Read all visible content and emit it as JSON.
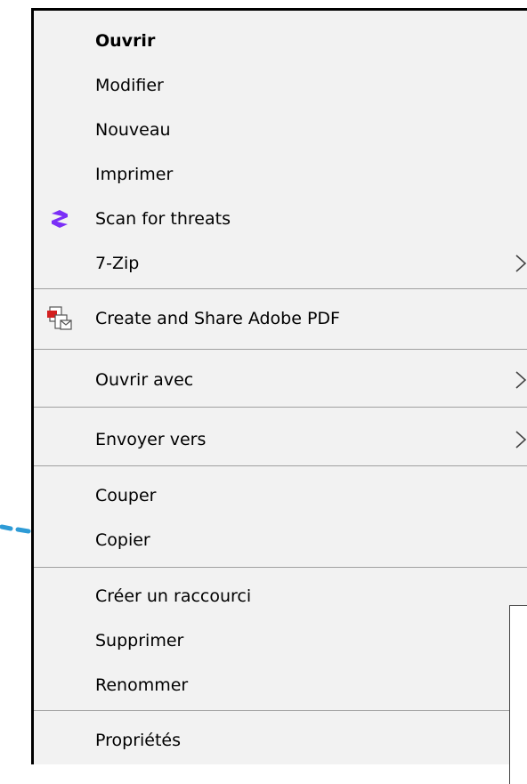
{
  "menu": {
    "items": [
      {
        "label": "Ouvrir"
      },
      {
        "label": "Modifier"
      },
      {
        "label": "Nouveau"
      },
      {
        "label": "Imprimer"
      },
      {
        "label": "Scan for threats",
        "icon": "shield-scan-icon"
      },
      {
        "label": "7-Zip",
        "icon": "chevron-right-icon"
      },
      {
        "label": "Create and Share Adobe PDF",
        "icon": "adobe-pdf-icon"
      },
      {
        "label": "Ouvrir avec",
        "icon": "chevron-right-icon"
      },
      {
        "label": "Envoyer vers",
        "icon": "chevron-right-icon"
      },
      {
        "label": "Couper"
      },
      {
        "label": "Copier"
      },
      {
        "label": "Créer un raccourci"
      },
      {
        "label": "Supprimer"
      },
      {
        "label": "Renommer"
      },
      {
        "label": "Propriétés"
      }
    ]
  },
  "colors": {
    "menu_background": "#f2f2f2",
    "separator": "#a0a0a0",
    "scan_icon": "#7b2ff7",
    "annotation_arrow": "#2e9bd6"
  }
}
